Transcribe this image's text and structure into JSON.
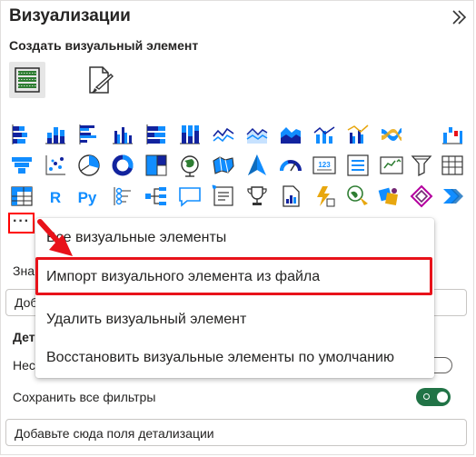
{
  "panel": {
    "title": "Визуализации",
    "subtitle": "Создать визуальный элемент",
    "icons": {
      "expand": "double-chevron-right-icon",
      "build_tab": "build-visual-icon",
      "format_tab": "format-visual-icon"
    }
  },
  "visuals": [
    [
      "stacked-bar-chart-icon",
      "stacked-column-chart-icon",
      "clustered-bar-chart-icon",
      "clustered-column-chart-icon",
      "100-stacked-bar-chart-icon",
      "100-stacked-column-chart-icon",
      "line-chart-icon",
      "area-chart-icon",
      "stacked-area-chart-icon",
      "line-and-stacked-column-chart-icon",
      "line-and-clustered-column-chart-icon",
      "ribbon-chart-icon",
      "waterfall-chart-icon"
    ],
    [
      "funnel-chart-icon",
      "scatter-chart-icon",
      "pie-chart-icon",
      "donut-chart-icon",
      "treemap-icon",
      "map-icon",
      "filled-map-icon",
      "azure-map-icon",
      "gauge-icon",
      "card-icon",
      "multi-row-card-icon",
      "kpi-icon",
      "slicer-icon",
      "table-icon"
    ],
    [
      "matrix-icon",
      "r-script-visual-icon",
      "python-visual-icon",
      "key-influencers-icon",
      "decomposition-tree-icon",
      "qa-icon",
      "smart-narrative-icon",
      "metrics-icon",
      "paginated-report-icon",
      "power-automate-icon",
      "arcgis-map-icon",
      "power-apps-icon",
      "get-more-visuals-icon",
      "power-automate-flow-icon"
    ]
  ],
  "more_button": {
    "label": "···"
  },
  "background": {
    "values_label": "Зна",
    "values_box": "Доб",
    "drillthrough_label": "Дет",
    "cross_report": "Нес",
    "keep_filters": "Сохранить все фильтры",
    "drill_field": "Добавьте сюда поля детализации"
  },
  "menu": {
    "items": [
      "Все визуальные элементы",
      "Импорт визуального элемента из файла",
      "Удалить визуальный элемент",
      "Восстановить визуальные элементы по умолчанию"
    ]
  },
  "colors": {
    "accent_blue": "#118dff",
    "dark_blue": "#12239e",
    "annotation_red": "#e8121a",
    "toggle_green": "#217346"
  }
}
